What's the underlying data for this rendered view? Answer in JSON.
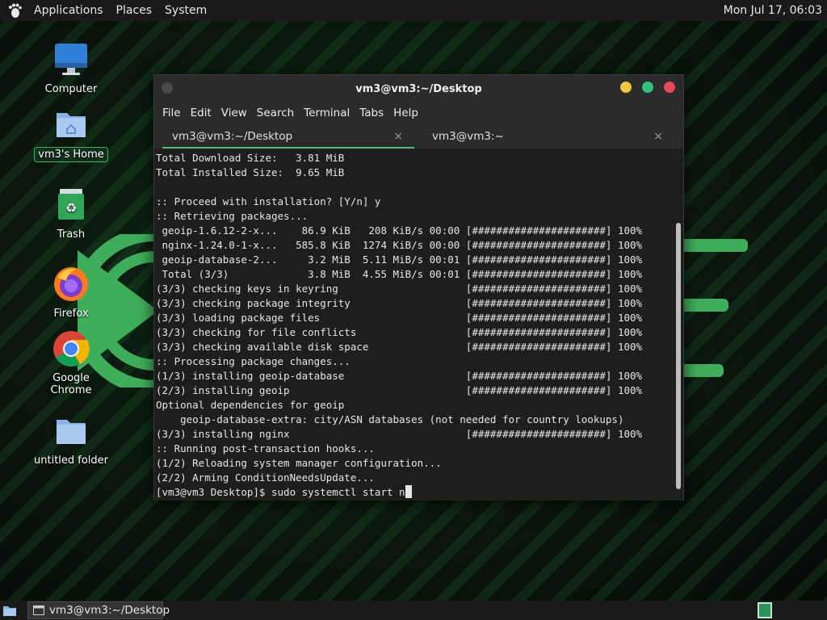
{
  "top_panel": {
    "menus": [
      "Applications",
      "Places",
      "System"
    ],
    "clock": "Mon Jul 17, 06:03",
    "logo_icon": "gnome-foot-icon"
  },
  "desktop_icons": [
    {
      "label": "Computer",
      "icon": "monitor-icon"
    },
    {
      "label": "vm3's Home",
      "icon": "home-folder-icon"
    },
    {
      "label": "Trash",
      "icon": "trash-icon"
    },
    {
      "label": "Firefox",
      "icon": "firefox-icon"
    },
    {
      "label": "Google Chrome",
      "icon": "chrome-icon"
    },
    {
      "label": "untitled folder",
      "icon": "folder-icon"
    }
  ],
  "window": {
    "title": "vm3@vm3:~/Desktop",
    "menu": [
      "File",
      "Edit",
      "View",
      "Search",
      "Terminal",
      "Tabs",
      "Help"
    ],
    "tabs": [
      {
        "label": "vm3@vm3:~/Desktop",
        "close": "×",
        "active": true
      },
      {
        "label": "vm3@vm3:~",
        "close": "×",
        "active": false
      }
    ],
    "terminal_lines": [
      "Total Download Size:   3.81 MiB",
      "Total Installed Size:  9.65 MiB",
      "",
      ":: Proceed with installation? [Y/n] y",
      ":: Retrieving packages...",
      " geoip-1.6.12-2-x...    86.9 KiB   208 KiB/s 00:00 [######################] 100%",
      " nginx-1.24.0-1-x...   585.8 KiB  1274 KiB/s 00:00 [######################] 100%",
      " geoip-database-2...     3.2 MiB  5.11 MiB/s 00:01 [######################] 100%",
      " Total (3/3)             3.8 MiB  4.55 MiB/s 00:01 [######################] 100%",
      "(3/3) checking keys in keyring                     [######################] 100%",
      "(3/3) checking package integrity                   [######################] 100%",
      "(3/3) loading package files                        [######################] 100%",
      "(3/3) checking for file conflicts                  [######################] 100%",
      "(3/3) checking available disk space                [######################] 100%",
      ":: Processing package changes...",
      "(1/3) installing geoip-database                    [######################] 100%",
      "(2/3) installing geoip                             [######################] 100%",
      "Optional dependencies for geoip",
      "    geoip-database-extra: city/ASN databases (not needed for country lookups)",
      "(3/3) installing nginx                             [######################] 100%",
      ":: Running post-transaction hooks...",
      "(1/2) Reloading system manager configuration...",
      "(2/2) Arming ConditionNeedsUpdate..."
    ],
    "prompt": "[vm3@vm3 Desktop]$ sudo systemctl start n"
  },
  "bottom_panel": {
    "task_label": "vm3@vm3:~/Desktop"
  },
  "colors": {
    "accent": "#4fbf78",
    "minimize": "#f0c43c",
    "maximize": "#2fc07a",
    "close": "#e54a5a"
  }
}
